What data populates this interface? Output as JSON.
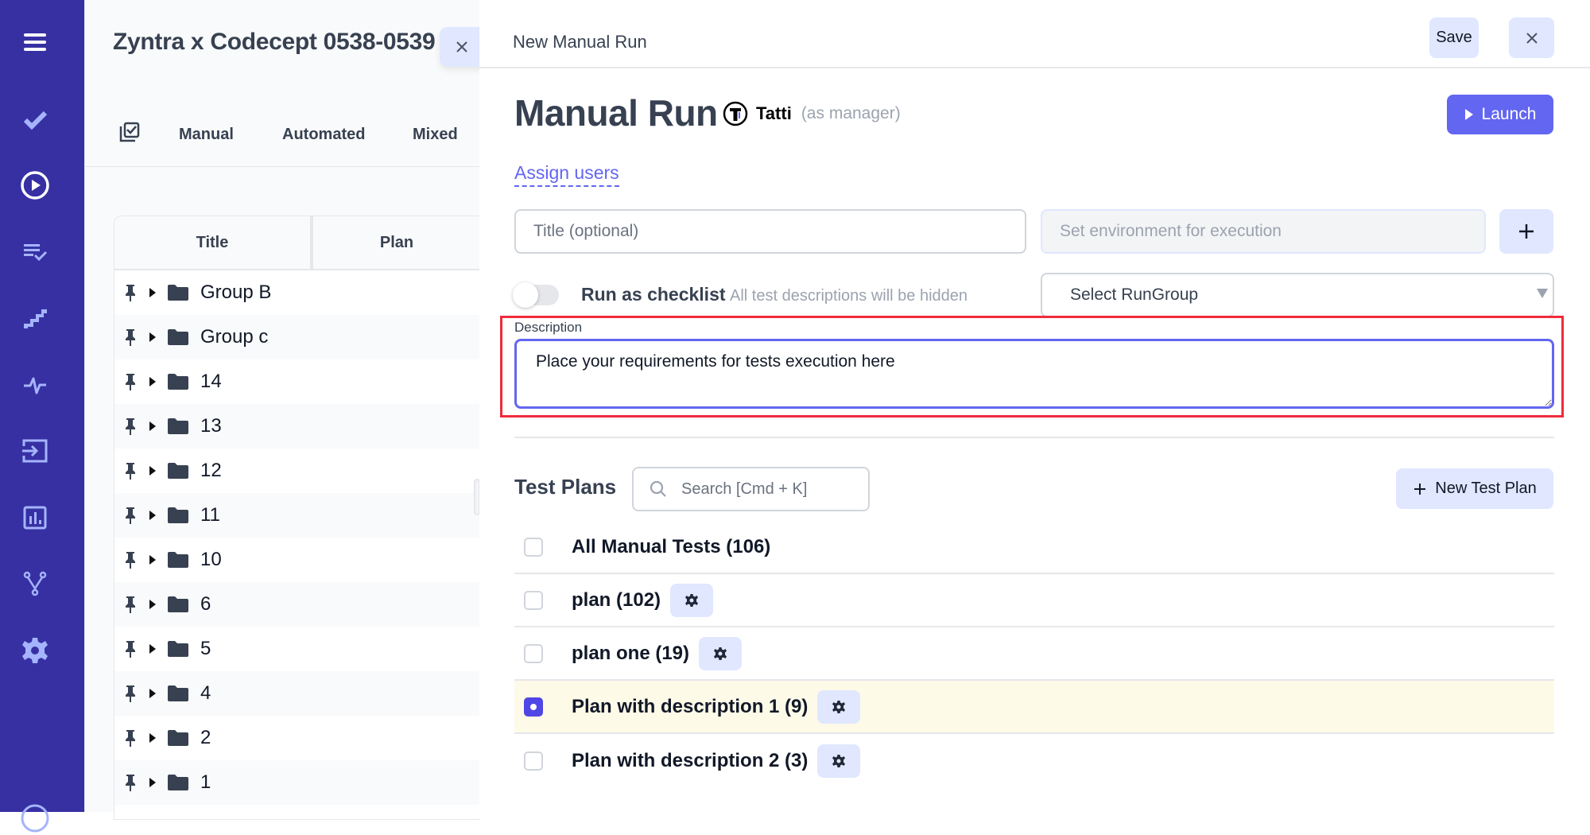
{
  "rail": {
    "icons": [
      "hamburger-menu-icon",
      "checkmark-icon",
      "play-circle-icon",
      "list-check-icon",
      "steps-icon",
      "pulse-icon",
      "import-icon",
      "analytics-icon",
      "branch-icon",
      "gear-icon",
      "help-icon"
    ],
    "color": "#3730a3",
    "active_icon": "play-circle-icon"
  },
  "project_panel": {
    "title": "Zyntra x Codecept 0538-0539",
    "tabs": [
      {
        "label": "Manual"
      },
      {
        "label": "Automated"
      },
      {
        "label": "Mixed"
      }
    ],
    "tree": {
      "columns": [
        "Title",
        "Plan"
      ],
      "rows": [
        {
          "name": "Group B"
        },
        {
          "name": "Group c"
        },
        {
          "name": "14"
        },
        {
          "name": "13"
        },
        {
          "name": "12"
        },
        {
          "name": "11"
        },
        {
          "name": "10"
        },
        {
          "name": "6"
        },
        {
          "name": "5"
        },
        {
          "name": "4"
        },
        {
          "name": "2"
        },
        {
          "name": "1"
        }
      ]
    }
  },
  "header": {
    "title": "New Manual Run",
    "save_label": "Save"
  },
  "run": {
    "title": "Manual Run",
    "manager_name": "Tatti",
    "manager_role": "(as manager)",
    "launch_label": "Launch",
    "assign_users_label": "Assign users",
    "title_placeholder": "Title (optional)",
    "environment_placeholder": "Set environment for execution",
    "checklist_label": "Run as checklist",
    "checklist_hint": "All test descriptions will be hidden",
    "checklist_enabled": false,
    "rungroup_placeholder": "Select RunGroup",
    "description_label": "Description",
    "description_value": "Place your requirements for tests execution here"
  },
  "test_plans": {
    "title": "Test Plans",
    "search_placeholder": "Search [Cmd + K]",
    "new_plan_label": "New Test Plan",
    "items": [
      {
        "label": "All Manual Tests (106)",
        "checked": false,
        "has_settings": false
      },
      {
        "label": "plan (102)",
        "checked": false,
        "has_settings": true
      },
      {
        "label": "plan one (19)",
        "checked": false,
        "has_settings": true
      },
      {
        "label": "Plan with description 1 (9)",
        "checked": true,
        "has_settings": true
      },
      {
        "label": "Plan with description 2 (3)",
        "checked": false,
        "has_settings": true
      }
    ]
  },
  "colors": {
    "accent": "#6366f1",
    "highlight_outline": "#ef2b3c",
    "selected_row": "#fefae8"
  }
}
